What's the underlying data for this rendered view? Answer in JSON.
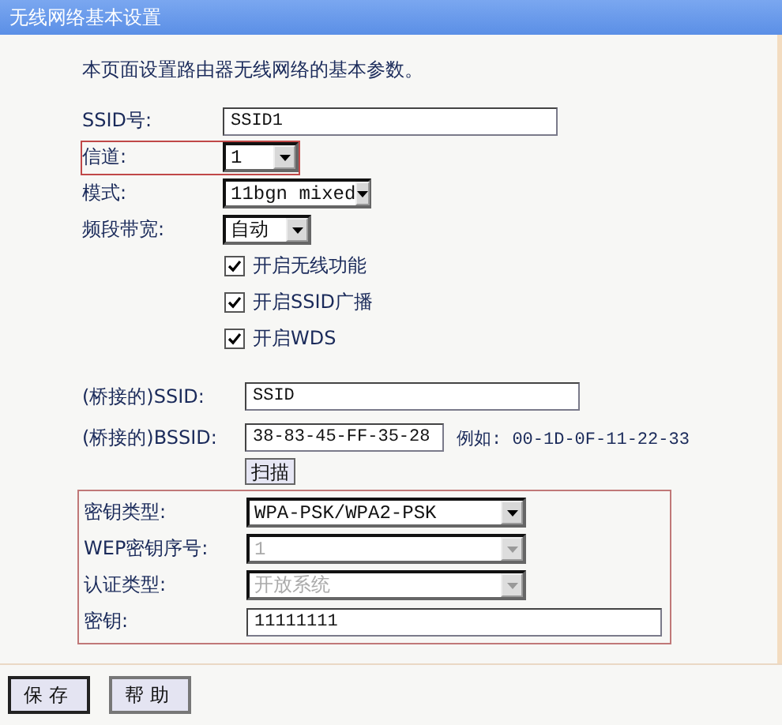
{
  "window": {
    "title": "无线网络基本设置"
  },
  "intro": "本页面设置路由器无线网络的基本参数。",
  "fields": [
    {
      "kind": "text",
      "label": "SSID号:",
      "value": "SSID1",
      "highlighted": false
    },
    {
      "kind": "select",
      "label": "信道:",
      "value": "1",
      "highlighted": true
    },
    {
      "kind": "select",
      "label": "模式:",
      "value": "11bgn mixed",
      "highlighted": false
    },
    {
      "kind": "select",
      "label": "频段带宽:",
      "value": "自动",
      "highlighted": false
    }
  ],
  "checkboxes": [
    {
      "label": "开启无线功能",
      "checked": true
    },
    {
      "label": "开启SSID广播",
      "checked": true
    },
    {
      "label": "开启WDS",
      "checked": true
    }
  ],
  "bridge_fields": [
    {
      "kind": "text",
      "label": "(桥接的)SSID:",
      "value": "SSID"
    },
    {
      "kind": "text",
      "label": "(桥接的)BSSID:",
      "value": "38-83-45-FF-35-28",
      "hint": "例如: 00-1D-0F-11-22-33"
    }
  ],
  "scan_button": "扫描",
  "security": {
    "highlighted": true,
    "fields": [
      {
        "kind": "select",
        "label": "密钥类型:",
        "value": "WPA-PSK/WPA2-PSK",
        "disabled": false
      },
      {
        "kind": "select",
        "label": "WEP密钥序号:",
        "value": "1",
        "disabled": true
      },
      {
        "kind": "select",
        "label": "认证类型:",
        "value": "开放系统",
        "disabled": true
      },
      {
        "kind": "text",
        "label": "密钥:",
        "value": "11111111",
        "disabled": false
      }
    ]
  },
  "buttons": [
    "保存",
    "帮助"
  ]
}
